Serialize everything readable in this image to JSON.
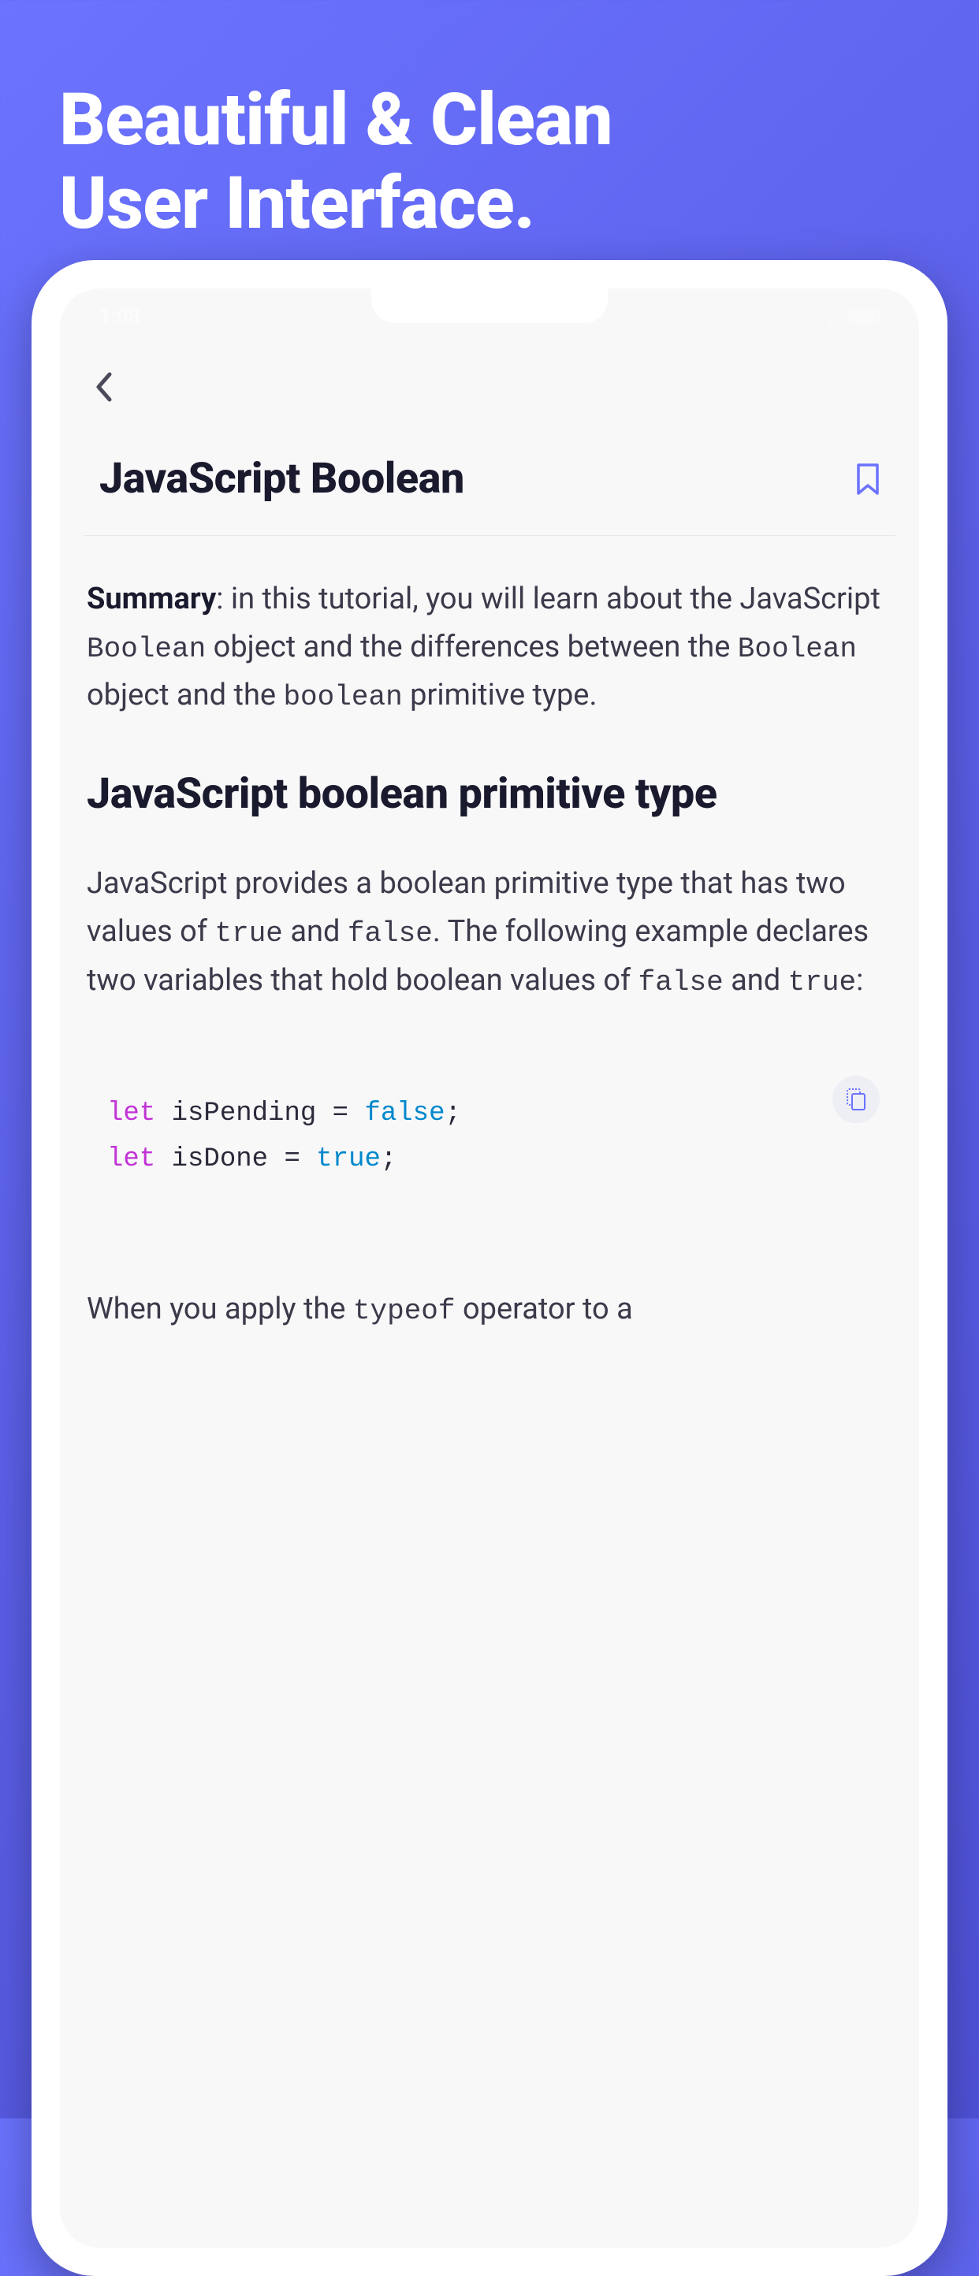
{
  "hero": {
    "title_line1": "Beautiful & Clean",
    "title_line2": "User Interface."
  },
  "status_bar": {
    "time": "1:08"
  },
  "article": {
    "title": "JavaScript Boolean",
    "summary_label": "Summary",
    "summary_text_1": ": in this tutorial, you will learn about the JavaScript ",
    "summary_code_1": "Boolean",
    "summary_text_2": " object and the differences between the ",
    "summary_code_2": "Boolean",
    "summary_text_3": " object and the ",
    "summary_code_3": "boolean",
    "summary_text_4": " primitive type.",
    "section_heading": "JavaScript boolean primitive type",
    "body_text_1": "JavaScript provides a boolean primitive type that has two values of ",
    "body_code_1": "true",
    "body_text_2": " and ",
    "body_code_2": "false",
    "body_text_3": ". The following example declares two variables that hold boolean values of ",
    "body_code_3": "false",
    "body_text_4": " and ",
    "body_code_4": "true",
    "body_text_5": ":",
    "code": {
      "line1_keyword": "let",
      "line1_var": " isPending = ",
      "line1_value": "false",
      "line1_end": ";",
      "line2_keyword": "let",
      "line2_var": " isDone = ",
      "line2_value": "true",
      "line2_end": ";"
    },
    "bottom_text_1": "When you apply the ",
    "bottom_code_1": "typeof",
    "bottom_text_2": " operator to a"
  }
}
